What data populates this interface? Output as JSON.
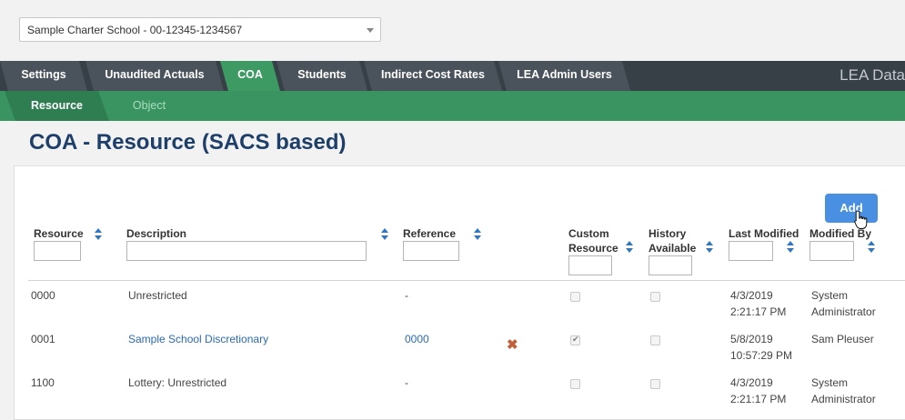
{
  "school_select": {
    "value": "Sample Charter School - 00-12345-1234567"
  },
  "nav": {
    "tabs": [
      {
        "label": "Settings",
        "active": false
      },
      {
        "label": "Unaudited Actuals",
        "active": false
      },
      {
        "label": "COA",
        "active": true
      },
      {
        "label": "Students",
        "active": false
      },
      {
        "label": "Indirect Cost Rates",
        "active": false
      },
      {
        "label": "LEA Admin Users",
        "active": false
      }
    ],
    "brand": "LEA Data"
  },
  "subnav": {
    "tabs": [
      {
        "label": "Resource",
        "active": true
      },
      {
        "label": "Object",
        "active": false
      }
    ]
  },
  "page_title": "COA - Resource (SACS based)",
  "add_button": "Add",
  "columns": {
    "resource": "Resource",
    "description": "Description",
    "reference": "Reference",
    "custom_resource_1": "Custom",
    "custom_resource_2": "Resource",
    "history_1": "History",
    "history_2": "Available",
    "last_modified": "Last Modified",
    "modified_by": "Modified By"
  },
  "rows": [
    {
      "resource": "0000",
      "description": "Unrestricted",
      "description_link": false,
      "reference": "-",
      "reference_link": false,
      "deletable": false,
      "custom": false,
      "history": false,
      "modified_date": "4/3/2019",
      "modified_time": "2:21:17 PM",
      "modified_by_1": "System",
      "modified_by_2": "Administrator"
    },
    {
      "resource": "0001",
      "description": "Sample School Discretionary",
      "description_link": true,
      "reference": "0000",
      "reference_link": true,
      "deletable": true,
      "custom": true,
      "history": false,
      "modified_date": "5/8/2019",
      "modified_time": "10:57:29 PM",
      "modified_by_1": "Sam Pleuser",
      "modified_by_2": ""
    },
    {
      "resource": "1100",
      "description": "Lottery: Unrestricted",
      "description_link": false,
      "reference": "-",
      "reference_link": false,
      "deletable": false,
      "custom": false,
      "history": false,
      "modified_date": "4/3/2019",
      "modified_time": "2:21:17 PM",
      "modified_by_1": "System",
      "modified_by_2": "Administrator"
    }
  ],
  "colors": {
    "nav_bg": "#384047",
    "tab_bg": "#4a535b",
    "active_green": "#3e9a63",
    "subnav_green": "#3a9462",
    "title_blue": "#1d3f6a",
    "link_blue": "#2a6ab8",
    "add_blue": "#4a90e2",
    "delete_red": "#c1603a"
  },
  "icons": {
    "dropdown": "chevron-down-icon",
    "sort": "sort-icon",
    "delete": "delete-x-icon",
    "cursor": "hand-pointer-icon"
  }
}
